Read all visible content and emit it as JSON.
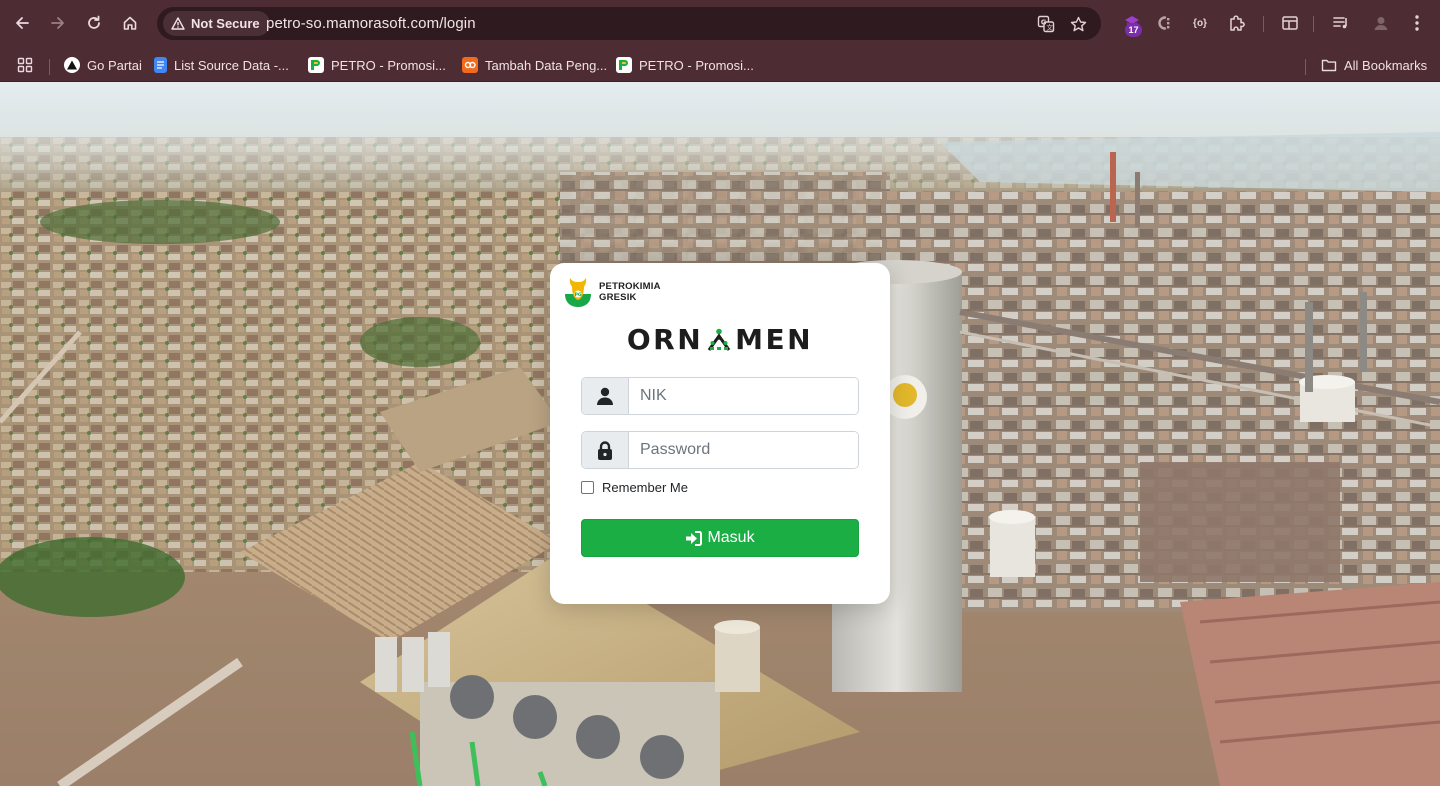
{
  "browser": {
    "security_label": "Not Secure",
    "url": "petro-so.mamorasoft.com/login",
    "extension_badge": "17",
    "extensions": [
      {
        "name": "ext-badge-icon"
      },
      {
        "name": "ext-c-icon"
      },
      {
        "name": "ext-brackets-icon",
        "label": "{o}"
      },
      {
        "name": "extensions-puzzle-icon"
      }
    ]
  },
  "bookmarks": {
    "items": [
      {
        "label": "Go Partai",
        "icon": "triangle-logo-icon",
        "color": "#111111"
      },
      {
        "label": "List Source Data -...",
        "icon": "docs-icon",
        "color": "#4285f4"
      },
      {
        "label": "PETRO - Promosi...",
        "icon": "petro-favicon-icon",
        "color": "#ffffff"
      },
      {
        "label": "Tambah Data Peng...",
        "icon": "orange-logo-icon",
        "color": "#f26b1d"
      },
      {
        "label": "PETRO - Promosi...",
        "icon": "petro-favicon-icon",
        "color": "#ffffff"
      }
    ],
    "all_bookmarks_label": "All Bookmarks"
  },
  "login": {
    "brand_line1": "PETROKIMIA",
    "brand_line2": "GRESIK",
    "app_title_left": "ORN",
    "app_title_right": "MEN",
    "nik_placeholder": "NIK",
    "password_placeholder": "Password",
    "remember_label": "Remember Me",
    "submit_label": "Masuk",
    "accent_color": "#1aae45"
  }
}
